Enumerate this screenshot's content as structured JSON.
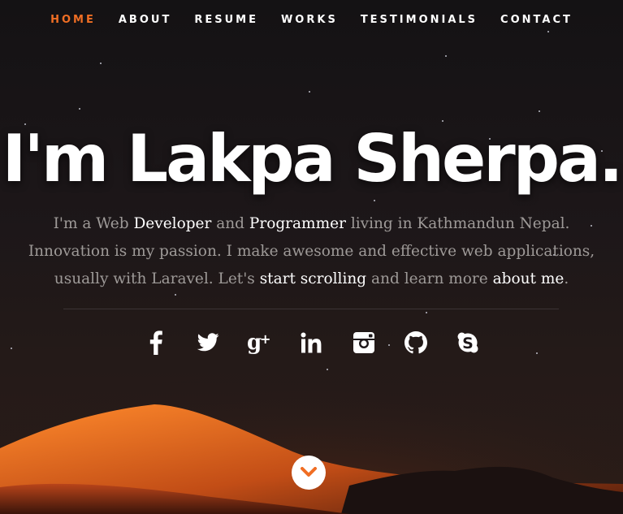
{
  "nav": {
    "items": [
      {
        "label": "HOME",
        "active": true
      },
      {
        "label": "ABOUT"
      },
      {
        "label": "RESUME"
      },
      {
        "label": "WORKS"
      },
      {
        "label": "TESTIMONIALS"
      },
      {
        "label": "CONTACT"
      }
    ]
  },
  "hero": {
    "title": "I'm Lakpa Sherpa.",
    "intro": {
      "p1": "I'm a Web ",
      "developer": "Developer",
      "p2": " and ",
      "programmer": "Programmer",
      "p3": " living in Kathmandun Nepal. Innovation is my passion. I make awesome and effective web applications, usually with Laravel. Let's ",
      "start_scrolling": "start scrolling",
      "p4": " and learn more ",
      "about_me": "about me",
      "p5": "."
    }
  },
  "social": {
    "icons": [
      "facebook-icon",
      "twitter-icon",
      "google-plus-icon",
      "linkedin-icon",
      "instagram-icon",
      "github-icon",
      "skype-icon"
    ]
  },
  "colors": {
    "accent": "#f06e24",
    "text": "#ffffff",
    "muted": "#9e9a98"
  }
}
